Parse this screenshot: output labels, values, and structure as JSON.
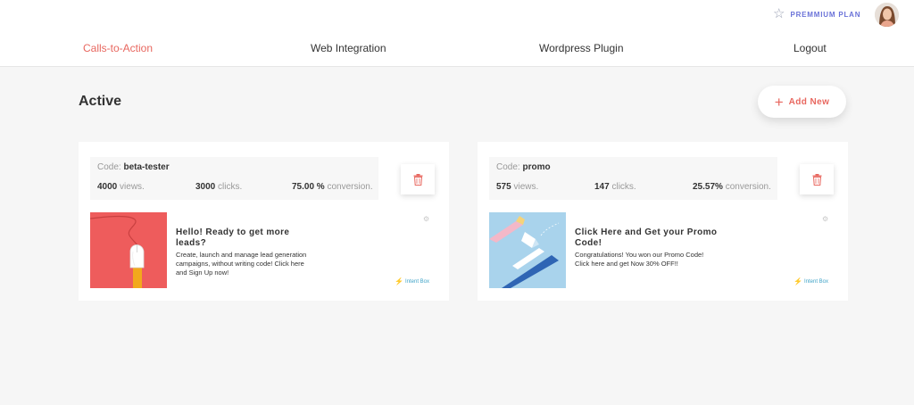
{
  "header": {
    "plan_label": "PREMMIUM PLAN",
    "star_icon": "star-outline",
    "nav": [
      {
        "label": "Calls-to-Action",
        "active": true
      },
      {
        "label": "Web Integration",
        "active": false
      },
      {
        "label": "Wordpress Plugin",
        "active": false
      },
      {
        "label": "Logout",
        "active": false
      }
    ]
  },
  "main": {
    "title": "Active",
    "add_button": {
      "icon": "plus",
      "label": "Add New"
    }
  },
  "cards": [
    {
      "code_label": "Code:",
      "code": "beta-tester",
      "views": "4000",
      "views_label": "views.",
      "clicks": "3000",
      "clicks_label": "clicks.",
      "conversion": "75.00 %",
      "conversion_label": "conversion.",
      "cta_title": "Hello! Ready to get more leads?",
      "cta_desc": "Create, launch and manage lead generation campaigns, without writing code! Click here and Sign Up now!",
      "type_label": "Intent Box"
    },
    {
      "code_label": "Code:",
      "code": "promo",
      "views": "575",
      "views_label": "views.",
      "clicks": "147",
      "clicks_label": "clicks.",
      "conversion": "25.57%",
      "conversion_label": "conversion.",
      "cta_title": "Click Here and Get your Promo Code!",
      "cta_desc": "Congratulations! You won our Promo Code! Click here and get Now 30% OFF!!",
      "type_label": "Intent Box"
    }
  ],
  "colors": {
    "accent": "#e8675f",
    "link": "#3fa3c7",
    "plan": "#6a72d8",
    "background": "#f6f6f6"
  }
}
